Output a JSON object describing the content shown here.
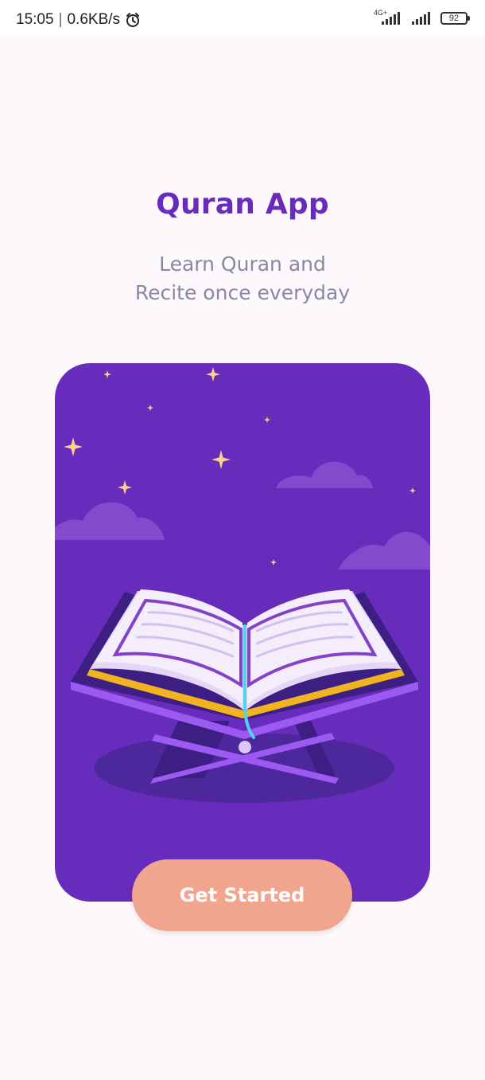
{
  "status_bar": {
    "time": "15:05",
    "separator": "|",
    "network_speed": "0.6KB/s",
    "network_type": "4G+",
    "battery": "92",
    "icons": [
      "alarm-icon",
      "signal-icon",
      "signal-icon",
      "battery-icon"
    ]
  },
  "onboarding": {
    "title": "Quran App",
    "subtitle_line1": "Learn Quran and",
    "subtitle_line2": "Recite once everyday",
    "cta_label": "Get Started"
  },
  "colors": {
    "brand_purple": "#672cbc",
    "subtitle_gray": "#8789a3",
    "cta_peach": "#f2a58e",
    "background": "#fdf8fc",
    "star_gold": "#ffd08b"
  },
  "illustration": {
    "icon": "open-quran-on-stand",
    "elements": [
      "stars",
      "clouds",
      "open-book",
      "book-stand"
    ]
  }
}
